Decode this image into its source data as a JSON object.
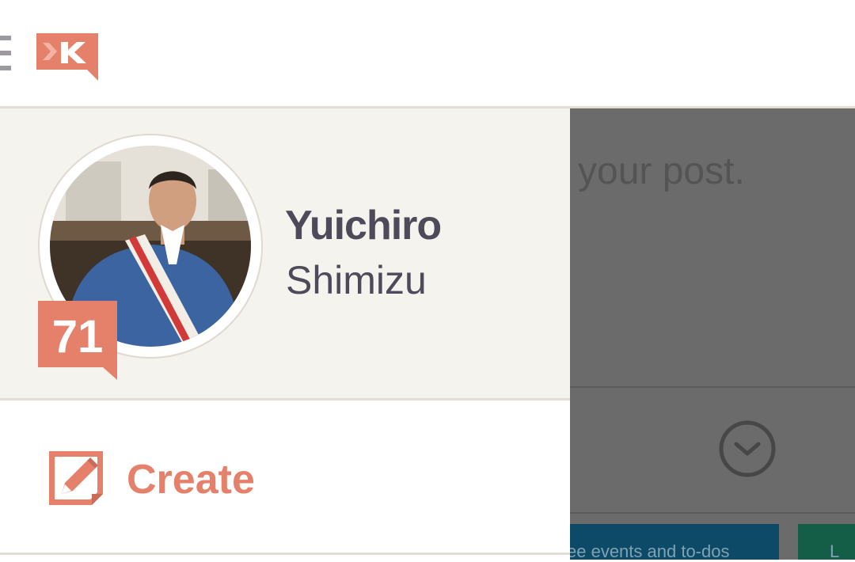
{
  "topbar": {
    "menu_icon": "hamburger-icon",
    "logo_icon": "klout-logo",
    "brand_color": "#e5806a"
  },
  "background": {
    "heading_fragment": "your post.",
    "card_text": "ee events and to-dos",
    "card2_text": "L",
    "clock_icon": "clock-icon"
  },
  "profile": {
    "first_name": "Yuichiro",
    "last_name": "Shimizu",
    "score": "71"
  },
  "menu": {
    "create_label": "Create",
    "create_icon": "edit-icon"
  }
}
